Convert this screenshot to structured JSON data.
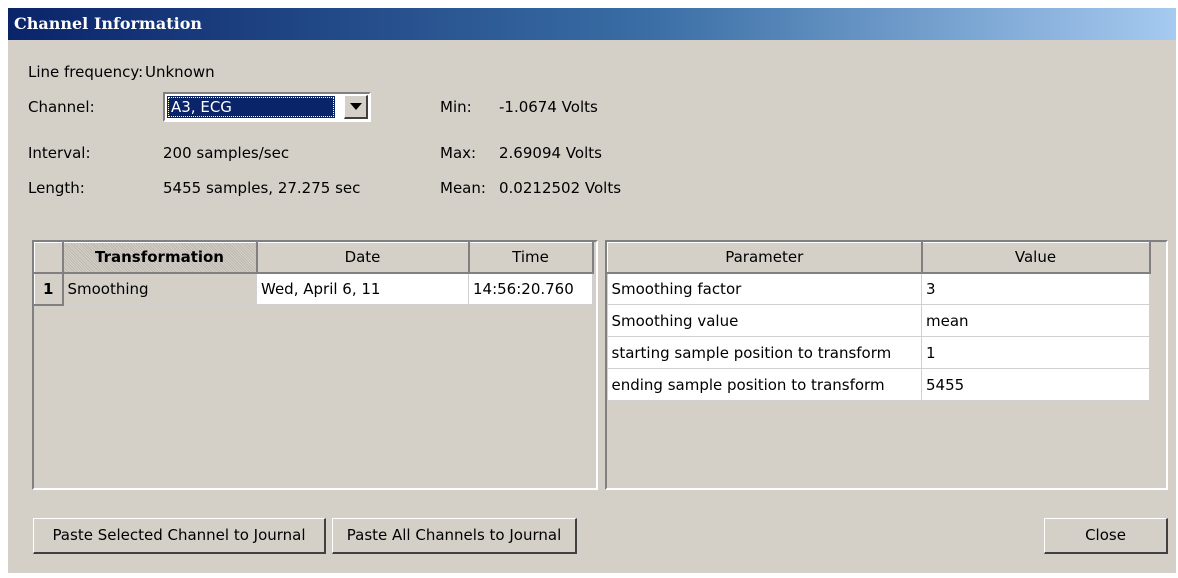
{
  "window": {
    "title": "Channel Information"
  },
  "info": {
    "line_frequency_label": "Line frequency:",
    "line_frequency_value": "Unknown",
    "channel_label": "Channel:",
    "channel_value": "A3, ECG",
    "interval_label": "Interval:",
    "interval_value": "200 samples/sec",
    "length_label": "Length:",
    "length_value": "5455 samples, 27.275 sec",
    "min_label": "Min:",
    "min_value": "-1.0674 Volts",
    "max_label": "Max:",
    "max_value": "2.69094 Volts",
    "mean_label": "Mean:",
    "mean_value": "0.0212502 Volts"
  },
  "transform_table": {
    "headers": [
      "Transformation",
      "Date",
      "Time"
    ],
    "rows": [
      {
        "num": "1",
        "transformation": "Smoothing",
        "date": "Wed, April 6, 11",
        "time": "14:56:20.760"
      }
    ]
  },
  "param_table": {
    "headers": [
      "Parameter",
      "Value"
    ],
    "rows": [
      {
        "parameter": "Smoothing factor",
        "value": "3"
      },
      {
        "parameter": "Smoothing value",
        "value": "mean"
      },
      {
        "parameter": "starting sample position to transform",
        "value": "1"
      },
      {
        "parameter": "ending sample position to transform",
        "value": "5455"
      }
    ]
  },
  "buttons": {
    "paste_selected": "Paste Selected Channel to Journal",
    "paste_all": "Paste All Channels to Journal",
    "close": "Close"
  }
}
